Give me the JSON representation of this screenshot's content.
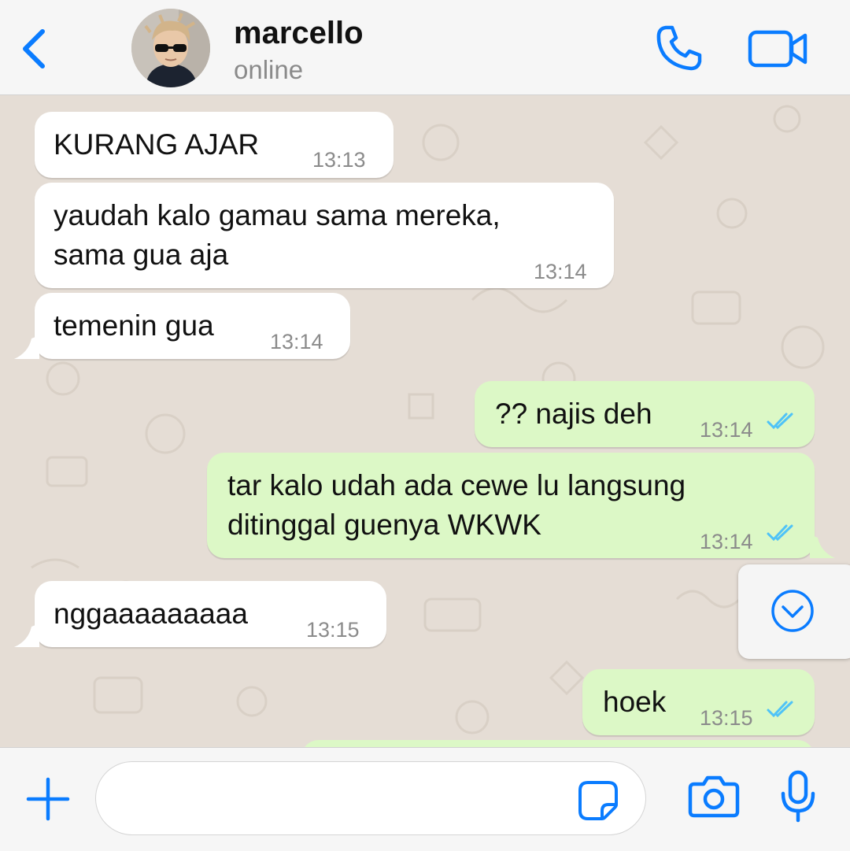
{
  "header": {
    "contact_name": "marcello",
    "status": "online",
    "icons": {
      "back": "chevron-left-icon",
      "call": "phone-icon",
      "video": "video-camera-icon"
    },
    "accent_color": "#0a7cff"
  },
  "messages": [
    {
      "direction": "incoming",
      "text": "KURANG AJAR",
      "time": "13:13"
    },
    {
      "direction": "incoming",
      "lines": [
        "yaudah kalo gamau sama mereka,",
        "sama gua aja"
      ],
      "time": "13:14"
    },
    {
      "direction": "incoming",
      "text": "temenin gua",
      "time": "13:14"
    },
    {
      "direction": "outgoing",
      "text": "?? najis deh",
      "time": "13:14",
      "status": "read"
    },
    {
      "direction": "outgoing",
      "lines": [
        "tar kalo udah ada cewe lu langsung",
        "ditinggal guenya WKWK"
      ],
      "time": "13:14",
      "status": "read"
    },
    {
      "direction": "incoming",
      "text": "nggaaaaaaaaa",
      "time": "13:15"
    },
    {
      "direction": "outgoing",
      "text": "hoek",
      "time": "13:15",
      "status": "read"
    }
  ],
  "colors": {
    "chat_background": "#e5ddd5",
    "incoming_bubble": "#ffffff",
    "outgoing_bubble": "#dcf8c6",
    "read_ticks": "#4fc3f7"
  },
  "composer": {
    "value": "",
    "icons": {
      "attach": "plus-icon",
      "sticker": "sticker-icon",
      "camera": "camera-icon",
      "mic": "microphone-icon"
    }
  },
  "scroll_button_icon": "chevron-down-circle-icon"
}
